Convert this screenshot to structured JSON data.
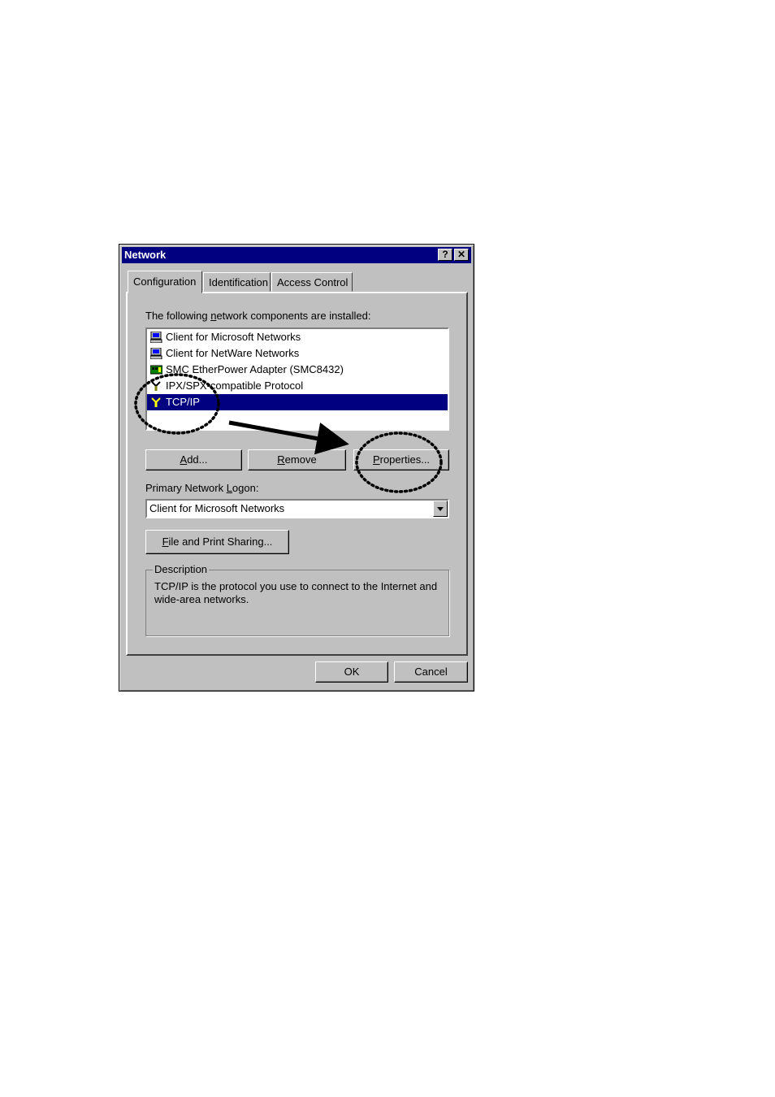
{
  "window": {
    "title": "Network",
    "help_glyph": "?",
    "close_glyph": "✕"
  },
  "tabs": [
    {
      "label": "Configuration",
      "active": true
    },
    {
      "label": "Identification",
      "active": false
    },
    {
      "label": "Access Control",
      "active": false
    }
  ],
  "components": {
    "label_prefix": "The following ",
    "label_accel": "n",
    "label_suffix": "etwork components are installed:",
    "items": [
      {
        "label": "Client for Microsoft Networks",
        "icon": "client-icon",
        "selected": false
      },
      {
        "label": "Client for NetWare Networks",
        "icon": "client-icon",
        "selected": false
      },
      {
        "label": "SMC EtherPower Adapter (SMC8432)",
        "icon": "network-adapter-icon",
        "selected": false
      },
      {
        "label": "IPX/SPX-compatible Protocol",
        "icon": "protocol-icon",
        "selected": false
      },
      {
        "label": "TCP/IP",
        "icon": "protocol-icon",
        "selected": true
      }
    ]
  },
  "buttons": {
    "add_accel": "A",
    "add_rest": "dd...",
    "remove_accel": "R",
    "remove_rest": "emove",
    "properties_accel": "P",
    "properties_rest": "roperties...",
    "file_print_accel": "F",
    "file_print_rest": "ile and Print Sharing...",
    "ok": "OK",
    "cancel": "Cancel"
  },
  "logon": {
    "label_prefix": "Primary Network ",
    "label_accel": "L",
    "label_suffix": "ogon:",
    "value": "Client for Microsoft Networks"
  },
  "description": {
    "title": "Description",
    "text": "TCP/IP is the protocol you use to connect to the Internet and wide-area networks."
  },
  "colors": {
    "face": "#c0c0c0",
    "titlebar": "#000080",
    "selection": "#000080"
  }
}
